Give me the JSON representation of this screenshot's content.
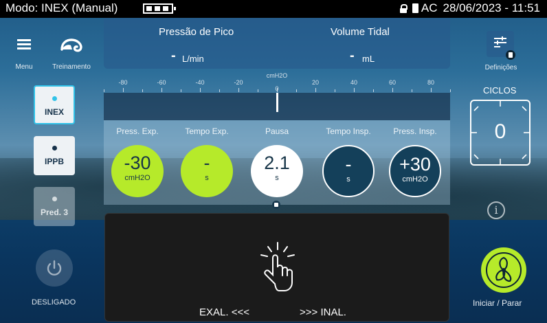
{
  "status_bar": {
    "mode": "Modo: INEX (Manual)",
    "power_source": "AC",
    "datetime": "28/06/2023 - 11:51"
  },
  "nav": {
    "menu_label": "Menu",
    "training_label": "Treinamento",
    "settings_label": "Definições"
  },
  "readouts": {
    "peak_pressure": {
      "title": "Pressão de Pico",
      "value": "-",
      "unit": "L/min"
    },
    "tidal_volume": {
      "title": "Volume Tidal",
      "value": "-",
      "unit": "mL"
    }
  },
  "gauge": {
    "unit": "cmH2O",
    "ticks": [
      "-80",
      "-60",
      "-40",
      "-20",
      "0",
      "20",
      "40",
      "60",
      "80"
    ],
    "current_value": 0
  },
  "parameters": [
    {
      "label": "Press. Exp.",
      "value": "-30",
      "unit": "cmH2O",
      "style": "green"
    },
    {
      "label": "Tempo Exp.",
      "value": "-",
      "unit": "s",
      "style": "green"
    },
    {
      "label": "Pausa",
      "value": "2.1",
      "unit": "s",
      "style": "white"
    },
    {
      "label": "Tempo Insp.",
      "value": "-",
      "unit": "s",
      "style": "dark"
    },
    {
      "label": "Press. Insp.",
      "value": "+30",
      "unit": "cmH2O",
      "style": "dark"
    }
  ],
  "modes": [
    {
      "label": "INEX",
      "active": true
    },
    {
      "label": "IPPB",
      "active": false
    },
    {
      "label": "Pred. 3",
      "active": false,
      "disabled": true
    }
  ],
  "touch_area": {
    "left_label": "EXAL. <<<",
    "right_label": ">>> INAL."
  },
  "cycles": {
    "label": "CICLOS",
    "count": "0"
  },
  "power": {
    "state_label": "DESLIGADO"
  },
  "start_stop": {
    "label": "Iniciar / Parar"
  },
  "colors": {
    "accent_green": "#b6ea2a",
    "dark_blue": "#14405a",
    "cyan": "#31c3e8"
  }
}
